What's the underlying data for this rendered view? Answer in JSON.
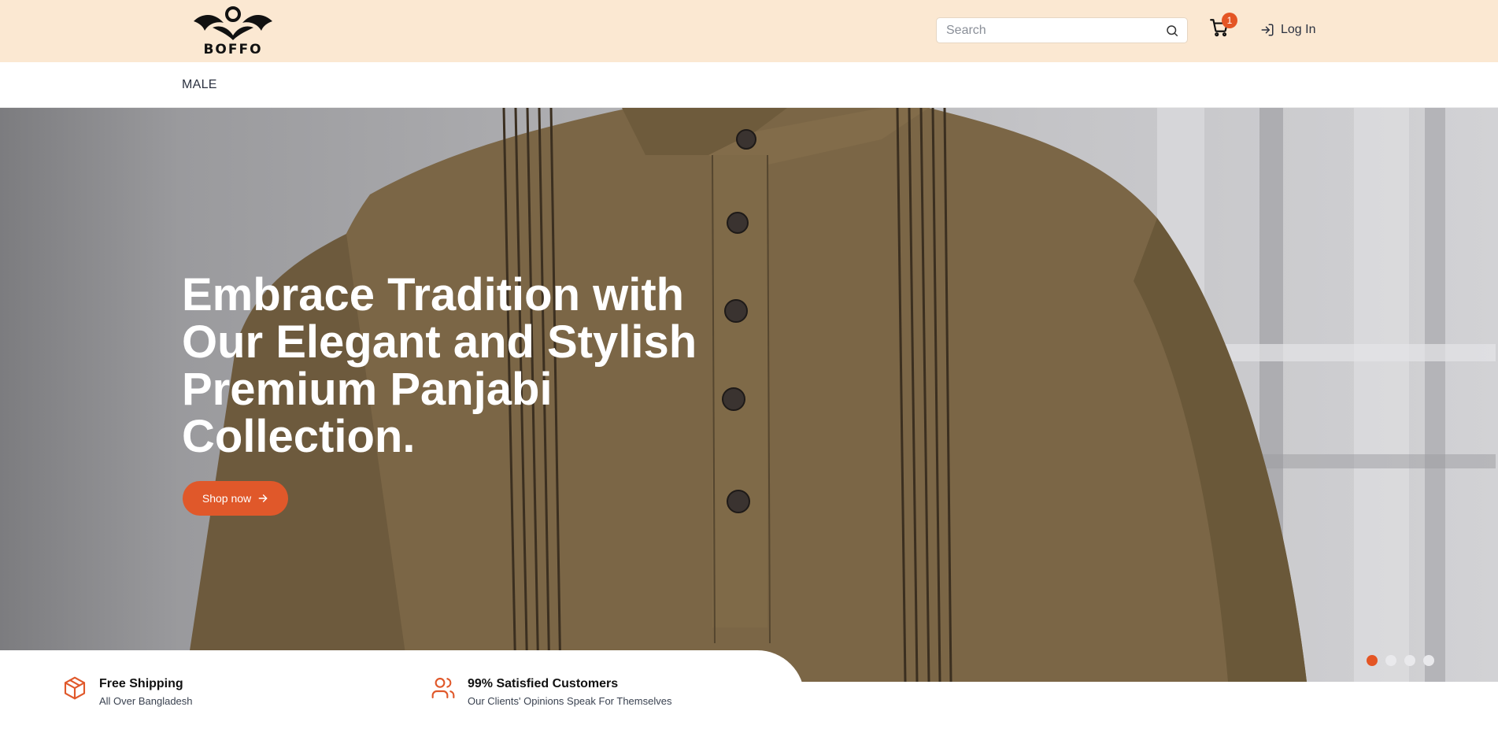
{
  "header": {
    "logo_text": "BOFFO",
    "search": {
      "placeholder": "Search",
      "icon": "search-icon"
    },
    "cart": {
      "icon": "cart-icon",
      "count": "1"
    },
    "login": {
      "label": "Log In",
      "icon": "login-icon"
    }
  },
  "nav": {
    "items": [
      {
        "label": "MALE"
      }
    ]
  },
  "hero": {
    "title": "Embrace Tradition with Our Elegant and Stylish Premium Panjabi Collection.",
    "cta_label": "Shop now",
    "cta_icon": "arrow-right-icon",
    "slides_total": 4,
    "active_slide": 1
  },
  "features": [
    {
      "icon": "package-icon",
      "title": "Free Shipping",
      "subtitle": "All Over Bangladesh"
    },
    {
      "icon": "users-icon",
      "title": "99% Satisfied Customers",
      "subtitle": "Our Clients' Opinions Speak For Themselves"
    }
  ],
  "colors": {
    "header_bg": "#fbe8d2",
    "accent": "#e0582a",
    "badge": "#e45524",
    "garment": "#7b6646"
  }
}
